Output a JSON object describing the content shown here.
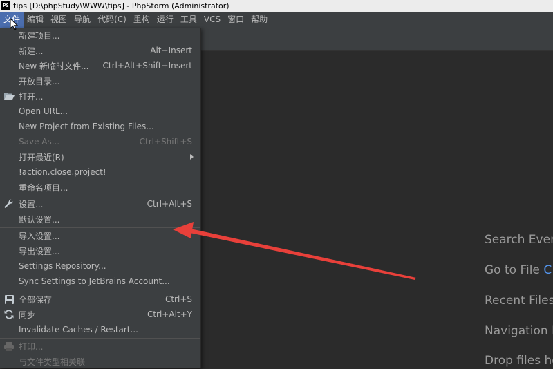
{
  "window": {
    "title": "tips [D:\\phpStudy\\WWW\\tips] - PhpStorm (Administrator)",
    "logo_text": "PS"
  },
  "menubar": [
    {
      "label": "文件",
      "active": true
    },
    {
      "label": "编辑"
    },
    {
      "label": "视图"
    },
    {
      "label": "导航"
    },
    {
      "label": "代码(C)"
    },
    {
      "label": "重构"
    },
    {
      "label": "运行"
    },
    {
      "label": "工具"
    },
    {
      "label": "VCS"
    },
    {
      "label": "窗口"
    },
    {
      "label": "帮助"
    }
  ],
  "file_menu": {
    "new_project": "新建项目...",
    "new": "新建...",
    "new_shortcut": "Alt+Insert",
    "new_scratch": "New 新临时文件...",
    "new_scratch_shortcut": "Ctrl+Alt+Shift+Insert",
    "open_directory": "开放目录...",
    "open": "打开...",
    "open_url": "Open URL...",
    "new_from_existing": "New Project from Existing Files...",
    "save_as": "Save As...",
    "save_as_shortcut": "Ctrl+Shift+S",
    "open_recent": "打开最近(R)",
    "close_project": "!action.close.project!",
    "rename_project": "重命名项目...",
    "settings": "设置...",
    "settings_shortcut": "Ctrl+Alt+S",
    "default_settings": "默认设置...",
    "import_settings": "导入设置...",
    "export_settings": "导出设置...",
    "settings_repository": "Settings Repository...",
    "sync_settings": "Sync Settings to JetBrains Account...",
    "save_all": "全部保存",
    "save_all_shortcut": "Ctrl+S",
    "synchronize": "同步",
    "synchronize_shortcut": "Ctrl+Alt+Y",
    "invalidate_caches": "Invalidate Caches / Restart...",
    "print": "打印...",
    "associate_file_type": "与文件类型相关联"
  },
  "welcome": {
    "search_everywhere": "Search Every",
    "go_to_file": "Go to File",
    "go_to_file_key": "C",
    "recent_files": "Recent Files",
    "navigation_bar": "Navigation I",
    "drop_files": "Drop files he"
  },
  "colors": {
    "annotation_arrow": "#e8403a",
    "menu_active": "#4b6eaf"
  }
}
